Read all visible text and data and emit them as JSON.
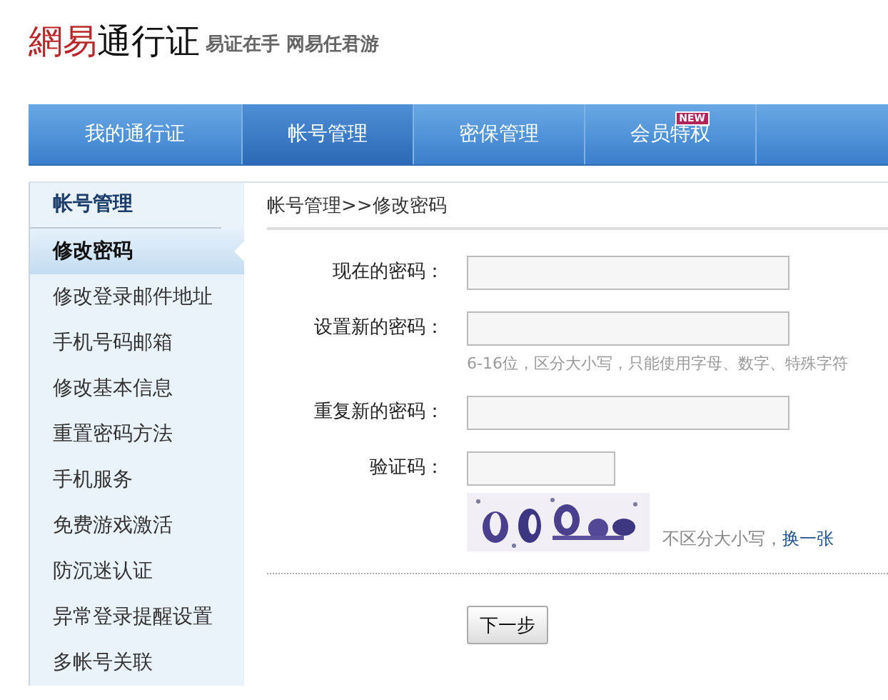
{
  "header": {
    "logo_brand": "網易",
    "logo_product": "通行证",
    "slogan": "易证在手 网易任君游"
  },
  "nav": {
    "tabs": [
      {
        "label": "我的通行证",
        "selected": false
      },
      {
        "label": "帐号管理",
        "selected": true
      },
      {
        "label": "密保管理",
        "selected": false
      },
      {
        "label": "会员特权",
        "selected": false,
        "badge": "NEW"
      }
    ]
  },
  "sidebar": {
    "title": "帐号管理",
    "items": [
      {
        "label": "修改密码",
        "selected": true
      },
      {
        "label": "修改登录邮件地址",
        "selected": false
      },
      {
        "label": "手机号码邮箱",
        "selected": false
      },
      {
        "label": "修改基本信息",
        "selected": false
      },
      {
        "label": "重置密码方法",
        "selected": false
      },
      {
        "label": "手机服务",
        "selected": false
      },
      {
        "label": "免费游戏激活",
        "selected": false
      },
      {
        "label": "防沉迷认证",
        "selected": false
      },
      {
        "label": "异常登录提醒设置",
        "selected": false
      },
      {
        "label": "多帐号关联",
        "selected": false
      }
    ]
  },
  "breadcrumb": "帐号管理>>修改密码",
  "form": {
    "fields": [
      {
        "kind": "text",
        "label": "现在的密码："
      },
      {
        "kind": "text",
        "label": "设置新的密码：",
        "hint": "6-16位，区分大小写，只能使用字母、数字、特殊字符"
      },
      {
        "kind": "text",
        "label": "重复新的密码："
      },
      {
        "kind": "captcha",
        "label": "验证码：",
        "hint": "不区分大小写，",
        "link": "换一张"
      }
    ]
  },
  "submit": "下一步"
}
